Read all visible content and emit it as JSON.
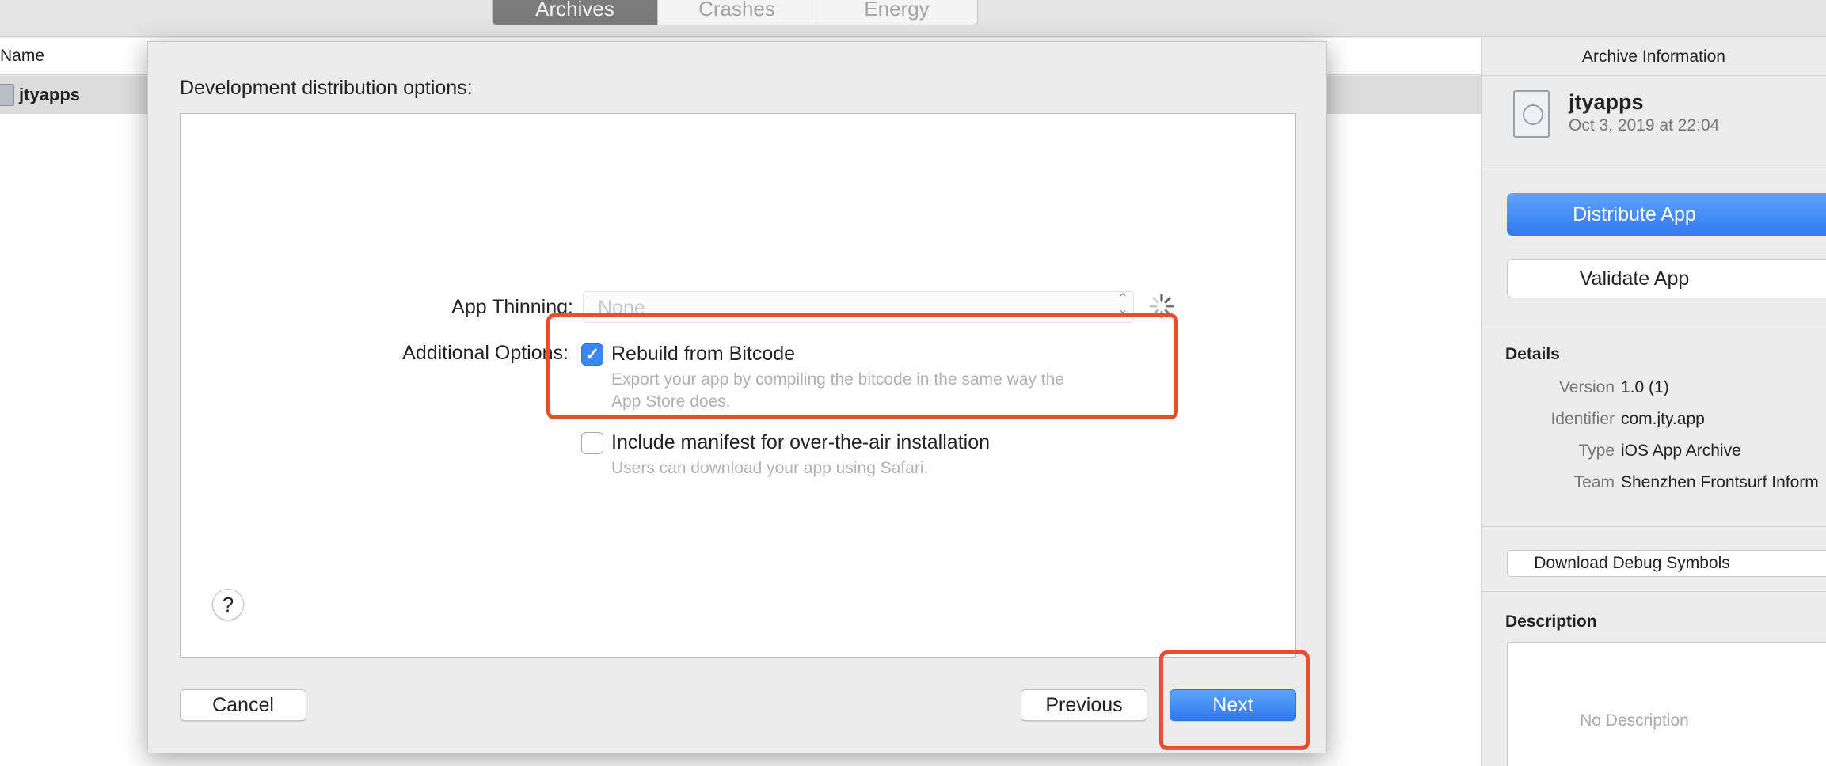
{
  "tabs": [
    "Archives",
    "Crashes",
    "Energy"
  ],
  "list": {
    "column_header": "Name",
    "rows": [
      {
        "name": "jtyapps"
      }
    ]
  },
  "dialog": {
    "title": "Development distribution options:",
    "app_thinning_label": "App Thinning:",
    "app_thinning_value": "None",
    "additional_options_label": "Additional Options:",
    "options": [
      {
        "title": "Rebuild from Bitcode",
        "desc_line1": "Export your app by compiling the bitcode in the same way the",
        "desc_line2": "App Store does.",
        "checked": true
      },
      {
        "title": "Include manifest for over-the-air installation",
        "desc_line1": "Users can download your app using Safari.",
        "checked": false
      }
    ],
    "help_label": "?",
    "cancel_label": "Cancel",
    "previous_label": "Previous",
    "next_label": "Next"
  },
  "inspector": {
    "title": "Archive Information",
    "archive_name": "jtyapps",
    "archive_date": "Oct 3, 2019 at 22:04",
    "distribute_label": "Distribute App",
    "validate_label": "Validate App",
    "details_title": "Details",
    "details": [
      {
        "key": "Version",
        "value": "1.0 (1)"
      },
      {
        "key": "Identifier",
        "value": "com.jty.app"
      },
      {
        "key": "Type",
        "value": "iOS App Archive"
      },
      {
        "key": "Team",
        "value": "Shenzhen Frontsurf Inform"
      }
    ],
    "debug_symbols_label": "Download Debug Symbols",
    "description_title": "Description",
    "description_placeholder": "No Description"
  },
  "colors": {
    "accent": "#3a87f5",
    "annotation": "#e34f2f"
  },
  "icons": [
    "archive-icon",
    "doc-archive-icon",
    "checkmark-icon",
    "spinner-icon",
    "updown-chevron-icon",
    "help-icon"
  ]
}
